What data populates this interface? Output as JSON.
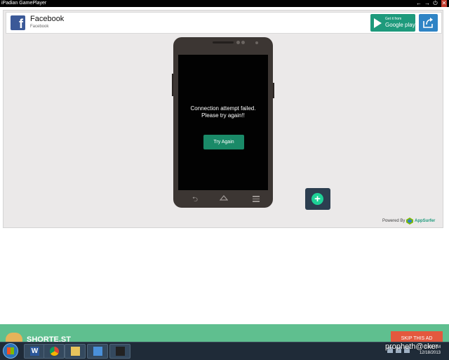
{
  "window": {
    "title": "iPadian GamePlayer"
  },
  "header": {
    "app_name": "Facebook",
    "app_sub": "Facebook"
  },
  "google_play": {
    "line1": "Get it from",
    "line2": "Google play"
  },
  "phone": {
    "message_line1": "Connection attempt failed.",
    "message_line2": "Please try again!!",
    "retry_label": "Try Again"
  },
  "powered": {
    "prefix": "Powered By",
    "brand": "AppSurfer"
  },
  "ad": {
    "brand": "SHORTE.ST",
    "skip_label": "SKIP THIS AD"
  },
  "taskbar": {
    "time": "5:38 PM",
    "date": "12/18/2013"
  },
  "watermark": "propheth@cker",
  "colors": {
    "accent": "#1a8a68",
    "facebook": "#3b5998",
    "ad_bg": "#5fbf8f",
    "skip": "#e4583e"
  }
}
